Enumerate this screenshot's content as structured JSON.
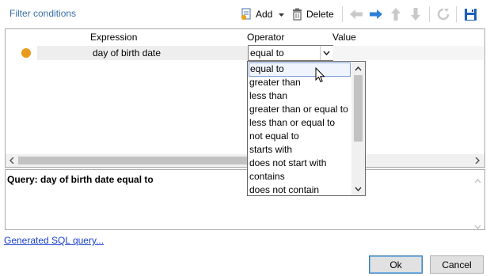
{
  "header": {
    "title": "Filter conditions",
    "add_label": "Add",
    "delete_label": "Delete"
  },
  "grid": {
    "columns": [
      "Expression",
      "Operator",
      "Value"
    ],
    "row": {
      "expression": "day of birth date",
      "operator": "equal to",
      "status_color": "#e89a1c"
    }
  },
  "dropdown": {
    "items": [
      "equal to",
      "greater than",
      "less than",
      "greater than or equal to",
      "less than or equal to",
      "not equal to",
      "starts with",
      "does not start with",
      "contains",
      "does not contain"
    ],
    "selected_index": 0
  },
  "query": {
    "text": "Query: day of birth date equal to"
  },
  "footer": {
    "sql_link": "Generated SQL query...",
    "ok_label": "Ok",
    "cancel_label": "Cancel"
  },
  "colors": {
    "accent": "#3a6ea8",
    "link": "#1a3fcf",
    "arrow_blue": "#2f7fd6",
    "save_blue": "#1e5fb5"
  }
}
